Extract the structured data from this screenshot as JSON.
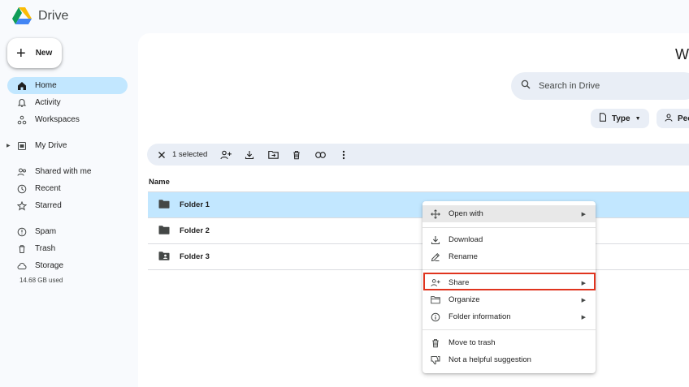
{
  "app": {
    "name": "Drive"
  },
  "new_button": {
    "label": "New"
  },
  "sidebar": {
    "items": [
      {
        "label": "Home",
        "icon": "home-icon",
        "active": true
      },
      {
        "label": "Activity",
        "icon": "bell-icon"
      },
      {
        "label": "Workspaces",
        "icon": "workspaces-icon"
      },
      {
        "label": "My Drive",
        "icon": "my-drive-icon"
      },
      {
        "label": "Shared with me",
        "icon": "shared-icon"
      },
      {
        "label": "Recent",
        "icon": "clock-icon"
      },
      {
        "label": "Starred",
        "icon": "star-icon"
      },
      {
        "label": "Spam",
        "icon": "spam-icon"
      },
      {
        "label": "Trash",
        "icon": "trash-icon"
      },
      {
        "label": "Storage",
        "icon": "cloud-icon"
      }
    ],
    "storage_used": "14.68 GB used"
  },
  "main": {
    "title_fragment": "W",
    "search_placeholder": "Search in Drive",
    "chips": [
      {
        "label": "Type"
      },
      {
        "label": "Peo"
      }
    ],
    "selection_bar": {
      "count_label": "1 selected"
    },
    "column_header": "Name",
    "files": [
      {
        "name": "Folder 1",
        "selected": true,
        "icon": "folder-icon"
      },
      {
        "name": "Folder 2",
        "selected": false,
        "icon": "folder-icon"
      },
      {
        "name": "Folder 3",
        "selected": false,
        "icon": "shared-folder-icon"
      }
    ]
  },
  "context_menu": {
    "items": [
      {
        "label": "Open with",
        "icon": "move-icon",
        "submenu": true
      },
      {
        "label": "Download",
        "icon": "download-icon"
      },
      {
        "label": "Rename",
        "icon": "rename-icon"
      },
      {
        "label": "Share",
        "icon": "share-icon",
        "submenu": true
      },
      {
        "label": "Organize",
        "icon": "organize-icon",
        "submenu": true
      },
      {
        "label": "Folder information",
        "icon": "info-icon",
        "submenu": true
      },
      {
        "label": "Move to trash",
        "icon": "trash-icon"
      },
      {
        "label": "Not a helpful suggestion",
        "icon": "thumbs-down-icon"
      }
    ]
  },
  "colors": {
    "accent_selected": "#c2e7ff",
    "highlight_border": "#e0341e",
    "surface": "#e9eef6"
  }
}
